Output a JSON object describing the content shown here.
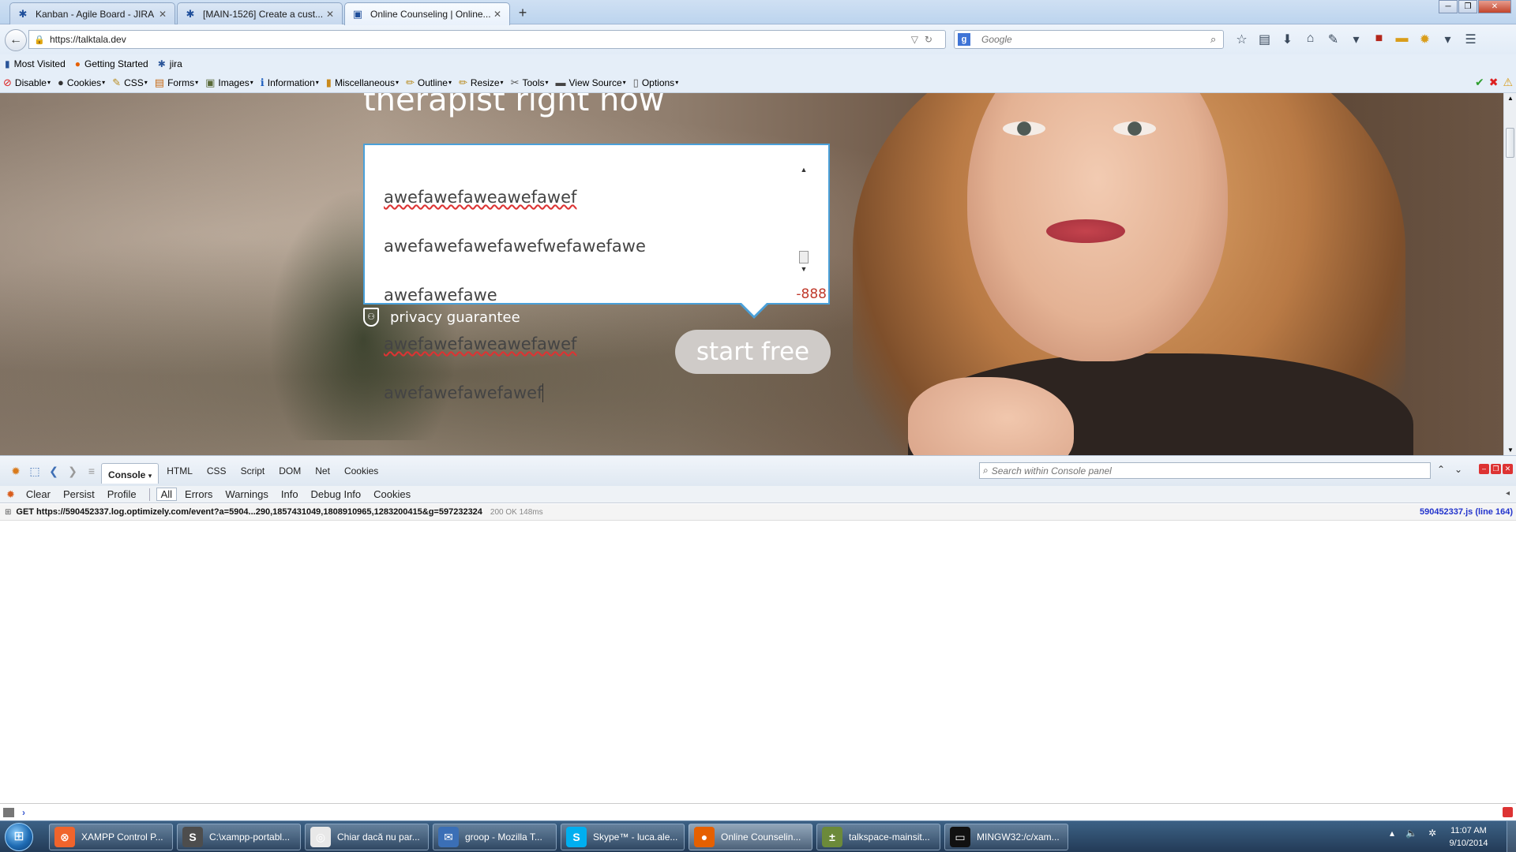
{
  "browser": {
    "tabs": [
      {
        "label": "Kanban - Agile Board - JIRA",
        "icon": "jira-icon",
        "active": false
      },
      {
        "label": "[MAIN-1526] Create a cust...",
        "icon": "jira-icon",
        "active": false
      },
      {
        "label": "Online Counseling | Online...",
        "icon": "talkspace-icon",
        "active": true
      }
    ],
    "new_tab": "+",
    "url": "https://talktala.dev",
    "search_placeholder": "Google",
    "bookmarks": [
      {
        "label": "Most Visited",
        "icon": "bookmark-icon"
      },
      {
        "label": "Getting Started",
        "icon": "firefox-icon"
      },
      {
        "label": "jira",
        "icon": "jira-icon"
      }
    ],
    "webdev_toolbar": [
      {
        "label": "Disable",
        "icon": "disable-icon"
      },
      {
        "label": "Cookies",
        "icon": "cookies-icon"
      },
      {
        "label": "CSS",
        "icon": "css-icon"
      },
      {
        "label": "Forms",
        "icon": "forms-icon"
      },
      {
        "label": "Images",
        "icon": "images-icon"
      },
      {
        "label": "Information",
        "icon": "information-icon"
      },
      {
        "label": "Miscellaneous",
        "icon": "miscellaneous-icon"
      },
      {
        "label": "Outline",
        "icon": "outline-icon"
      },
      {
        "label": "Resize",
        "icon": "resize-icon"
      },
      {
        "label": "Tools",
        "icon": "tools-icon"
      },
      {
        "label": "View Source",
        "icon": "view-source-icon"
      },
      {
        "label": "Options",
        "icon": "options-icon"
      }
    ]
  },
  "page": {
    "hero_title": "therapist right now",
    "message_lines": [
      {
        "text": "awefawefaweawefawef",
        "misspelled": true
      },
      {
        "text": "awefawefawefawefwefawefawe",
        "misspelled": false
      },
      {
        "text": "awefawefawe",
        "misspelled": false
      },
      {
        "text": "awefawefaweawefawef",
        "misspelled": true
      },
      {
        "text": "awefawefawefawef",
        "misspelled": false
      }
    ],
    "char_counter": "-888",
    "privacy_label": "privacy guarantee",
    "start_button": "start free"
  },
  "firebug": {
    "panel_tabs": [
      "Console",
      "HTML",
      "CSS",
      "Script",
      "DOM",
      "Net",
      "Cookies"
    ],
    "active_panel": "Console",
    "search_placeholder": "Search within Console panel",
    "console_buttons": [
      "Clear",
      "Persist",
      "Profile"
    ],
    "filters": [
      "All",
      "Errors",
      "Warnings",
      "Info",
      "Debug Info",
      "Cookies"
    ],
    "active_filter": "All",
    "log_entry": {
      "request": "GET https://590452337.log.optimizely.com/event?a=5904...290,1857431049,1808910965,1283200415&g=597232324",
      "status": "200 OK 148ms",
      "source": "590452337.js (line 164)"
    },
    "prompt": "›"
  },
  "taskbar": {
    "items": [
      {
        "label": "XAMPP Control P...",
        "icon": "xampp-icon",
        "color": "#f0642c",
        "active": false
      },
      {
        "label": "C:\\xampp-portabl...",
        "icon": "sublime-icon",
        "color": "#4d4d4d",
        "active": false
      },
      {
        "label": "Chiar dacă nu par...",
        "icon": "chrome-icon",
        "color": "#e8e8e8",
        "active": false
      },
      {
        "label": "groop - Mozilla T...",
        "icon": "thunderbird-icon",
        "color": "#3b6fb6",
        "active": false
      },
      {
        "label": "Skype™ - luca.ale...",
        "icon": "skype-icon",
        "color": "#00aff0",
        "active": false
      },
      {
        "label": "Online Counselin...",
        "icon": "firefox-icon",
        "color": "#e66000",
        "active": true
      },
      {
        "label": "talkspace-mainsit...",
        "icon": "git-icon",
        "color": "#6c8a3a",
        "active": false
      },
      {
        "label": "MINGW32:/c/xam...",
        "icon": "terminal-icon",
        "color": "#111111",
        "active": false
      }
    ],
    "time": "11:07 AM",
    "date": "9/10/2014"
  }
}
